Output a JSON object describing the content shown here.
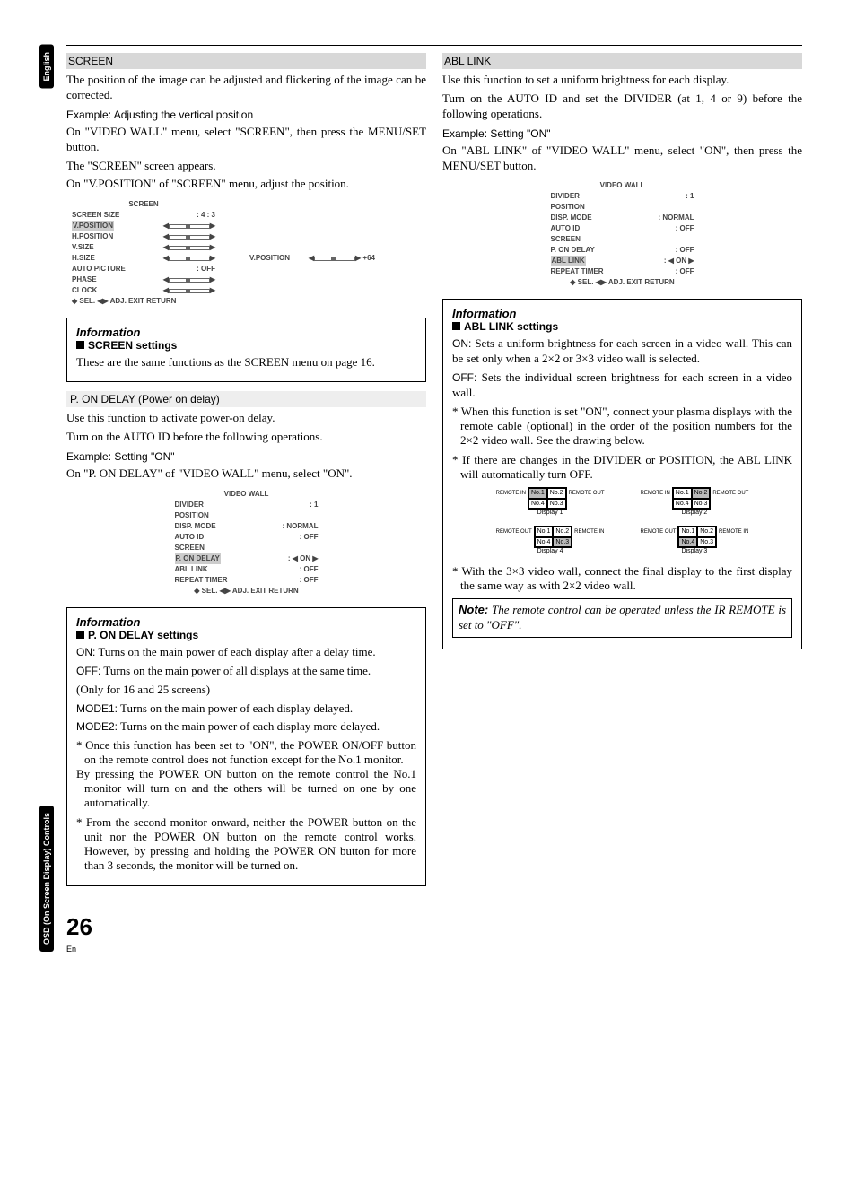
{
  "sideTabs": {
    "english": "English",
    "osd": "OSD (On Screen Display) Controls"
  },
  "left": {
    "screen": {
      "heading": "SCREEN",
      "p1": "The position of the image can be adjusted and flickering of the image can be corrected.",
      "example": "Example: Adjusting the vertical position",
      "p2": "On \"VIDEO WALL\" menu, select \"SCREEN\", then press the MENU/SET button.",
      "p3": "The \"SCREEN\" screen appears.",
      "p4": "On \"V.POSITION\" of \"SCREEN\" menu, adjust the position.",
      "osd": {
        "title": "SCREEN",
        "rows": [
          [
            "SCREEN SIZE",
            ":   4 : 3"
          ],
          [
            "V.POSITION",
            "slider"
          ],
          [
            "H.POSITION",
            "slider"
          ],
          [
            "V.SIZE",
            "slider"
          ],
          [
            "H.SIZE",
            "slider"
          ],
          [
            "AUTO PICTURE",
            ":   OFF"
          ],
          [
            "PHASE",
            "slider"
          ],
          [
            "CLOCK",
            "slider"
          ]
        ],
        "footer": "◆ SEL.    ◀▶ ADJ.    EXIT RETURN",
        "callout_label": "V.POSITION",
        "callout_val": "+64"
      },
      "info": {
        "title": "Information",
        "sub": "SCREEN settings",
        "body": "These are the same functions as the SCREEN menu on page 16."
      }
    },
    "pon": {
      "heading": "P. ON DELAY (Power on delay)",
      "p1": "Use this function to activate power-on delay.",
      "p2": "Turn on the AUTO ID before the following operations.",
      "example": "Example: Setting \"ON\"",
      "p3": "On \"P. ON DELAY\" of \"VIDEO WALL\" menu, select \"ON\".",
      "osd": {
        "title": "VIDEO WALL",
        "rows": [
          [
            "DIVIDER",
            ":   1"
          ],
          [
            "POSITION",
            ""
          ],
          [
            "DISP. MODE",
            ":   NORMAL"
          ],
          [
            "AUTO ID",
            ":   OFF"
          ],
          [
            "SCREEN",
            ""
          ],
          [
            "P. ON DELAY",
            ": ◀ ON ▶"
          ],
          [
            "ABL LINK",
            ":   OFF"
          ],
          [
            "REPEAT TIMER",
            ":   OFF"
          ]
        ],
        "footer": "◆ SEL.    ◀▶ ADJ.    EXIT RETURN"
      },
      "info": {
        "title": "Information",
        "sub": "P. ON DELAY settings",
        "on": "Turns on the main power of each display after a delay time.",
        "off": "Turns on the main power of all displays at the same time.",
        "only": "(Only for 16 and 25 screens)",
        "mode1": "Turns on the main power of each display delayed.",
        "mode2": "Turns on the main power of each display more delayed.",
        "star1a": "Once this function has been set to \"ON\", the POWER ON/OFF button on the remote control does not function except for the No.1 monitor.",
        "star1b": "By pressing the POWER ON button on the remote control the No.1 monitor will turn on and the others will be turned on one by one automatically.",
        "star2": "From the second monitor onward, neither the POWER button on the unit nor the POWER ON button on the remote control works. However, by pressing and holding the POWER ON button for more than 3 seconds, the monitor will be turned on."
      }
    }
  },
  "right": {
    "abl": {
      "heading": "ABL LINK",
      "p1": "Use this function to set a uniform brightness for each display.",
      "p2": "Turn on the AUTO ID and set the DIVIDER (at 1, 4 or 9) before the following operations.",
      "example": "Example: Setting \"ON\"",
      "p3": "On \"ABL LINK\" of \"VIDEO WALL\" menu, select \"ON\", then press the MENU/SET button.",
      "osd": {
        "title": "VIDEO WALL",
        "rows": [
          [
            "DIVIDER",
            ":   1"
          ],
          [
            "POSITION",
            ""
          ],
          [
            "DISP. MODE",
            ":   NORMAL"
          ],
          [
            "AUTO ID",
            ":   OFF"
          ],
          [
            "SCREEN",
            ""
          ],
          [
            "P. ON DELAY",
            ":   OFF"
          ],
          [
            "ABL LINK",
            ": ◀ ON ▶"
          ],
          [
            "REPEAT TIMER",
            ":   OFF"
          ]
        ],
        "footer": "◆ SEL.    ◀▶ ADJ.    EXIT RETURN"
      },
      "info": {
        "title": "Information",
        "sub": "ABL LINK settings",
        "on": "Sets a uniform brightness for each screen in a video wall. This can be set only when a 2×2 or 3×3 video wall is selected.",
        "off": "Sets the individual screen brightness for each screen in a video wall.",
        "star1": "When this function is set \"ON\", connect your plasma displays with the remote cable (optional) in the order of the position numbers for the 2×2 video wall. See the drawing below.",
        "star2": "If there are changes in the DIVIDER or POSITION, the ABL LINK will automatically turn OFF.",
        "diagram": {
          "units": [
            {
              "label": "Display 1",
              "shade": 0,
              "left": "REMOTE IN",
              "right": "REMOTE OUT"
            },
            {
              "label": "Display 2",
              "shade": 1,
              "left": "REMOTE IN",
              "right": "REMOTE OUT"
            },
            {
              "label": "Display 4",
              "shade": 3,
              "left": "REMOTE OUT",
              "right": "REMOTE IN"
            },
            {
              "label": "Display 3",
              "shade": 2,
              "left": "REMOTE OUT",
              "right": "REMOTE IN"
            }
          ],
          "cells": [
            "No.1",
            "No.2",
            "No.4",
            "No.3"
          ]
        }
      },
      "afterStar": "With the 3×3 video wall, connect the final display to the first display the same way as with 2×2 video wall.",
      "noteLabel": "Note:",
      "note": "The remote control can be operated unless the IR REMOTE is set to \"OFF\"."
    }
  },
  "labels": {
    "on": "ON:",
    "off": "OFF:",
    "mode1": "MODE1:",
    "mode2": "MODE2:"
  },
  "footer": {
    "page": "26",
    "en": "En"
  }
}
